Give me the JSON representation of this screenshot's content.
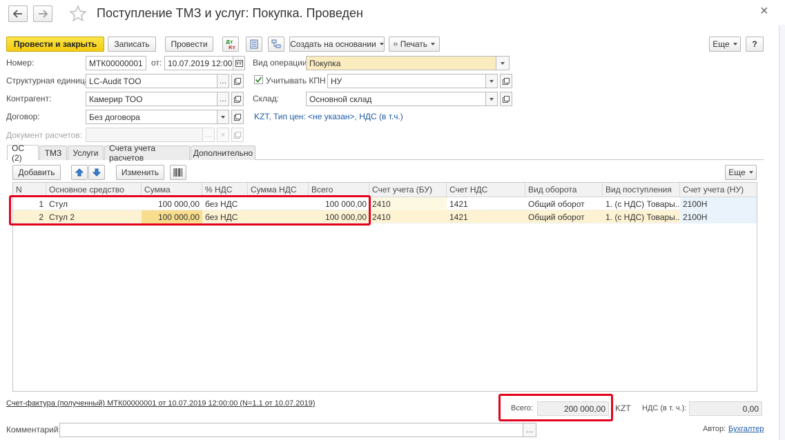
{
  "window": {
    "title": "Поступление ТМЗ и услуг: Покупка. Проведен",
    "close_glyph": "×"
  },
  "toolbar": {
    "post_close": "Провести и закрыть",
    "save": "Записать",
    "post": "Провести",
    "create_based": "Создать на основании",
    "print": "Печать",
    "more": "Еще",
    "help": "?"
  },
  "header": {
    "number_label": "Номер:",
    "number_value": "МТК00000001",
    "date_label": "от:",
    "date_value": "10.07.2019 12:00:0",
    "op_label": "Вид операции:",
    "op_value": "Покупка",
    "unit_label": "Структурная единица:",
    "unit_value": "LC-Audit TOO",
    "kpn_label": "Учитывать КПН",
    "kpn_value": "НУ",
    "contractor_label": "Контрагент:",
    "contractor_value": "Камерир ТОО",
    "warehouse_label": "Склад:",
    "warehouse_value": "Основной склад",
    "contract_label": "Договор:",
    "contract_value": "Без договора",
    "price_link": "KZT, Тип цен: <не указан>, НДС (в т.ч.)",
    "settlement_label": "Документ расчетов:",
    "settlement_value": ""
  },
  "tabs": [
    "ОС (2)",
    "ТМЗ",
    "Услуги",
    "Счета учета расчетов",
    "Дополнительно"
  ],
  "table_toolbar": {
    "add": "Добавить",
    "edit": "Изменить",
    "more": "Еще"
  },
  "table": {
    "columns": [
      "N",
      "Основное средство",
      "Сумма",
      "% НДС",
      "Сумма НДС",
      "Всего",
      "Счет учета (БУ)",
      "Счет НДС",
      "Вид оборота",
      "Вид поступления",
      "Счет учета (НУ)"
    ],
    "rows": [
      [
        "1",
        "Стул",
        "100 000,00",
        "без НДС",
        "",
        "100 000,00",
        "2410",
        "1421",
        "Общий оборот",
        "1. (с НДС) Товары...",
        "2100Н"
      ],
      [
        "2",
        "Стул 2",
        "100 000,00",
        "без НДС",
        "",
        "100 000,00",
        "2410",
        "1421",
        "Общий оборот",
        "1. (с НДС) Товары...",
        "2100Н"
      ]
    ]
  },
  "footer": {
    "invoice_link": "Счет-фактура (полученный) МТК00000001 от 10.07.2019 12:00:00 (N=1.1 от 10.07.2019)",
    "total_label": "Всего:",
    "total_value": "200 000,00",
    "currency": "KZT",
    "vat_label": "НДС (в т. ч.):",
    "vat_value": "0,00",
    "comment_label": "Комментарий:",
    "comment_value": "",
    "author_label": "Автор:",
    "author_value": "Бухгалтер"
  },
  "colors": {
    "accent_yellow": "#f4cc10",
    "highlight_red": "#e3001b",
    "link_blue": "#1c5aa8",
    "row_selected": "#fbecc0"
  }
}
